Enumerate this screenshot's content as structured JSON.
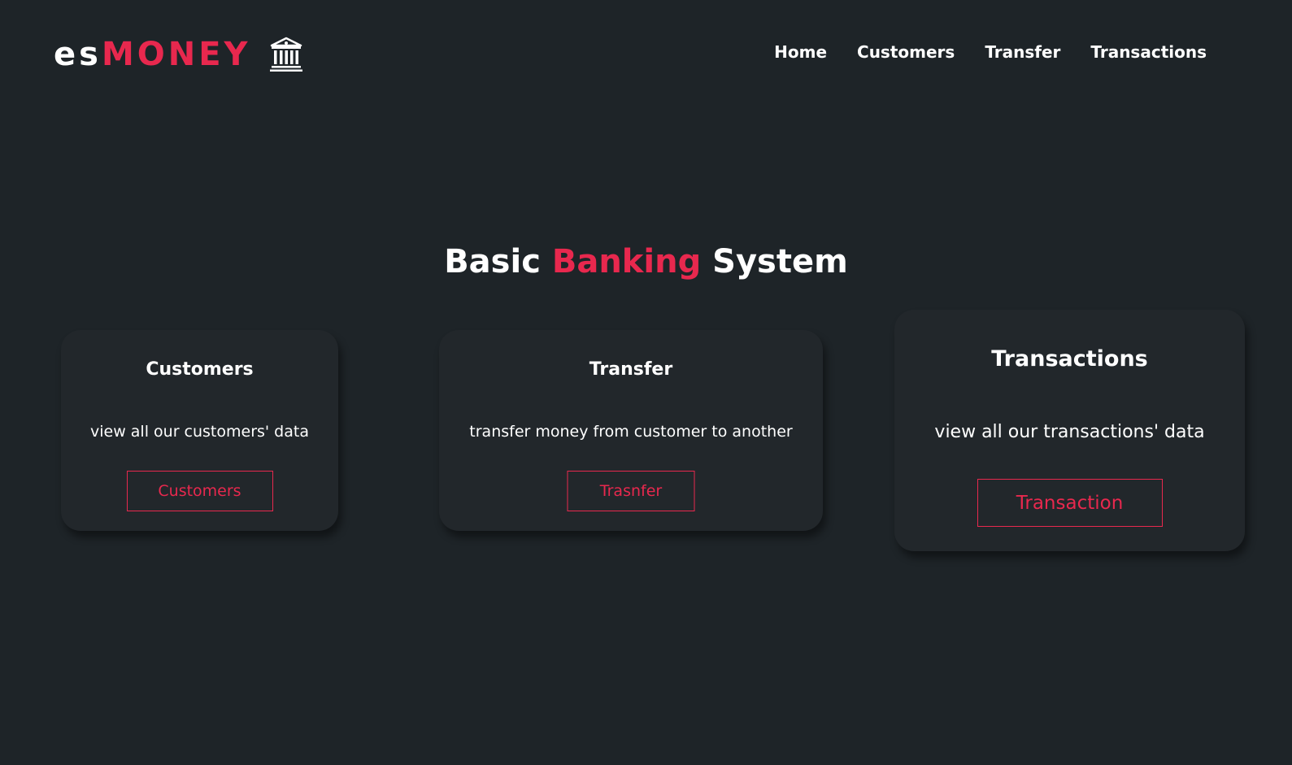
{
  "header": {
    "logo_part1": "es",
    "logo_part2": "MONEY",
    "logo_icon": "bank-icon"
  },
  "nav": {
    "items": [
      {
        "label": "Home"
      },
      {
        "label": "Customers"
      },
      {
        "label": "Transfer"
      },
      {
        "label": "Transactions"
      }
    ]
  },
  "hero": {
    "title_part1": "Basic",
    "title_accent": "Banking",
    "title_part2": "System"
  },
  "cards": [
    {
      "title": "Customers",
      "description": "view all our customers' data",
      "button_label": "Customers"
    },
    {
      "title": "Transfer",
      "description": "transfer money from customer to another",
      "button_label": "Trasnfer"
    },
    {
      "title": "Transactions",
      "description": "view all our transactions' data",
      "button_label": "Transaction"
    }
  ],
  "colors": {
    "background": "#1e2428",
    "card_background": "#22272b",
    "accent": "#e8284e",
    "text": "#ffffff"
  }
}
